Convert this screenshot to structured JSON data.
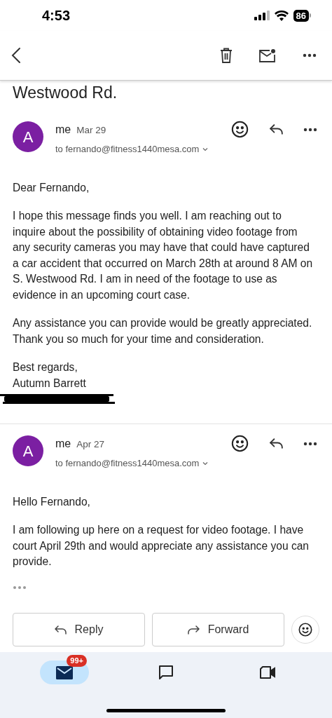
{
  "status_bar": {
    "time": "4:53",
    "battery": "86"
  },
  "subject": [
    "Westwood Rd."
  ],
  "messages": [
    {
      "avatar": "A",
      "sender": "me",
      "date": "Mar 29",
      "recipient": "to fernando@fitness1440mesa.com",
      "redacted": true,
      "trimmed": false,
      "body": [
        "Dear Fernando,",
        "I hope this message finds you well. I am reaching out to inquire about the possibility of obtaining video footage from any security cameras you may have that could have captured a car accident that occurred on March 28th at around 8 AM on S. Westwood Rd. I am in need of the footage to use as evidence in an upcoming court case.",
        "Any assistance you can provide would be greatly appreciated. Thank you so much for your time and consideration."
      ],
      "signature": [
        "Best regards,",
        "Autumn Barrett"
      ]
    },
    {
      "avatar": "A",
      "sender": "me",
      "date": "Apr 27",
      "recipient": "to fernando@fitness1440mesa.com",
      "redacted": false,
      "trimmed": true,
      "body": [
        "Hello Fernando,",
        "I am following up here on a request for video footage. I have court April 29th and would appreciate any assistance you can provide."
      ]
    }
  ],
  "actions": [
    {
      "kind": "reply",
      "label": "Reply"
    },
    {
      "kind": "forward",
      "label": "Forward"
    }
  ],
  "nav": [
    {
      "kind": "mail",
      "selected": true,
      "badge": "99+"
    },
    {
      "kind": "chat",
      "selected": false
    },
    {
      "kind": "video",
      "selected": false
    }
  ]
}
